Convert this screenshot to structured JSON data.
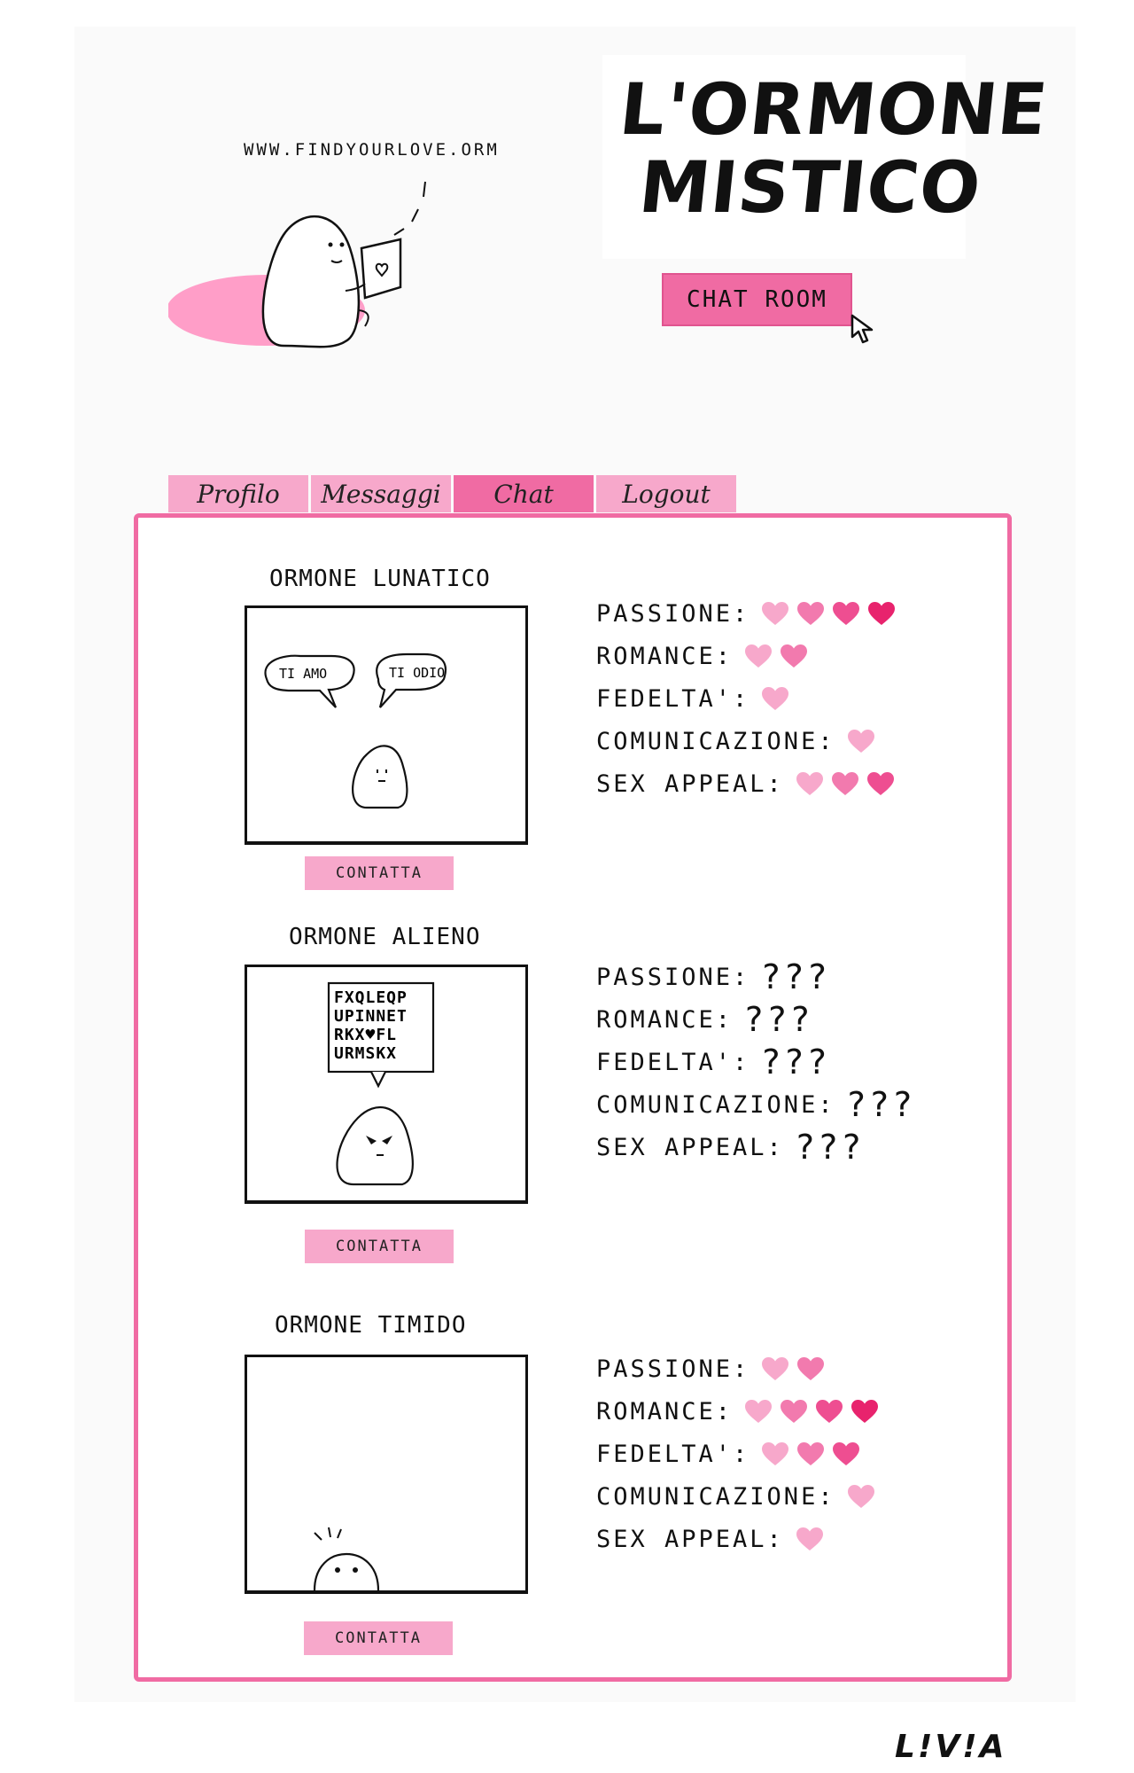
{
  "header": {
    "url": "WWW.FINDYOURLOVE.ORM",
    "logo_line1": "L'ORMONE",
    "logo_line2": "MISTICO",
    "chat_room_button": "CHAT ROOM",
    "signature": "L!V!A"
  },
  "tabs": [
    {
      "label": "Profilo",
      "active": false
    },
    {
      "label": "Messaggi",
      "active": false
    },
    {
      "label": "Chat",
      "active": true
    },
    {
      "label": "Logout",
      "active": false
    }
  ],
  "stat_labels": [
    "PASSIONE:",
    "ROMANCE:",
    "FEDELTA':",
    "COMUNICAZIONE:",
    "SEX APPEAL:"
  ],
  "cards": [
    {
      "title": "ORMONE LUNATICO",
      "bubbles": [
        "TI AMO",
        "TI ODIO"
      ],
      "button": "CONTATTA",
      "stats": [
        4,
        2,
        1,
        1,
        3
      ]
    },
    {
      "title": "ORMONE ALIENO",
      "letter_grid": [
        "FXQLEQP",
        "UPINNET",
        "RKX♥FL",
        "URMSKX"
      ],
      "button": "CONTATTA",
      "stats_unknown": "???"
    },
    {
      "title": "ORMONE TIMIDO",
      "button": "CONTATTA",
      "stats": [
        2,
        4,
        3,
        1,
        1
      ]
    }
  ],
  "colors": {
    "accent": "#f06ba3",
    "accent_light": "#f7a8cb",
    "heart_shades": [
      "#f7a8cb",
      "#f27aae",
      "#ee4e91",
      "#e8236d"
    ],
    "blob": "#ff9ec8"
  },
  "icons": [
    "heart-icon",
    "cursor-icon",
    "laptop-icon"
  ]
}
